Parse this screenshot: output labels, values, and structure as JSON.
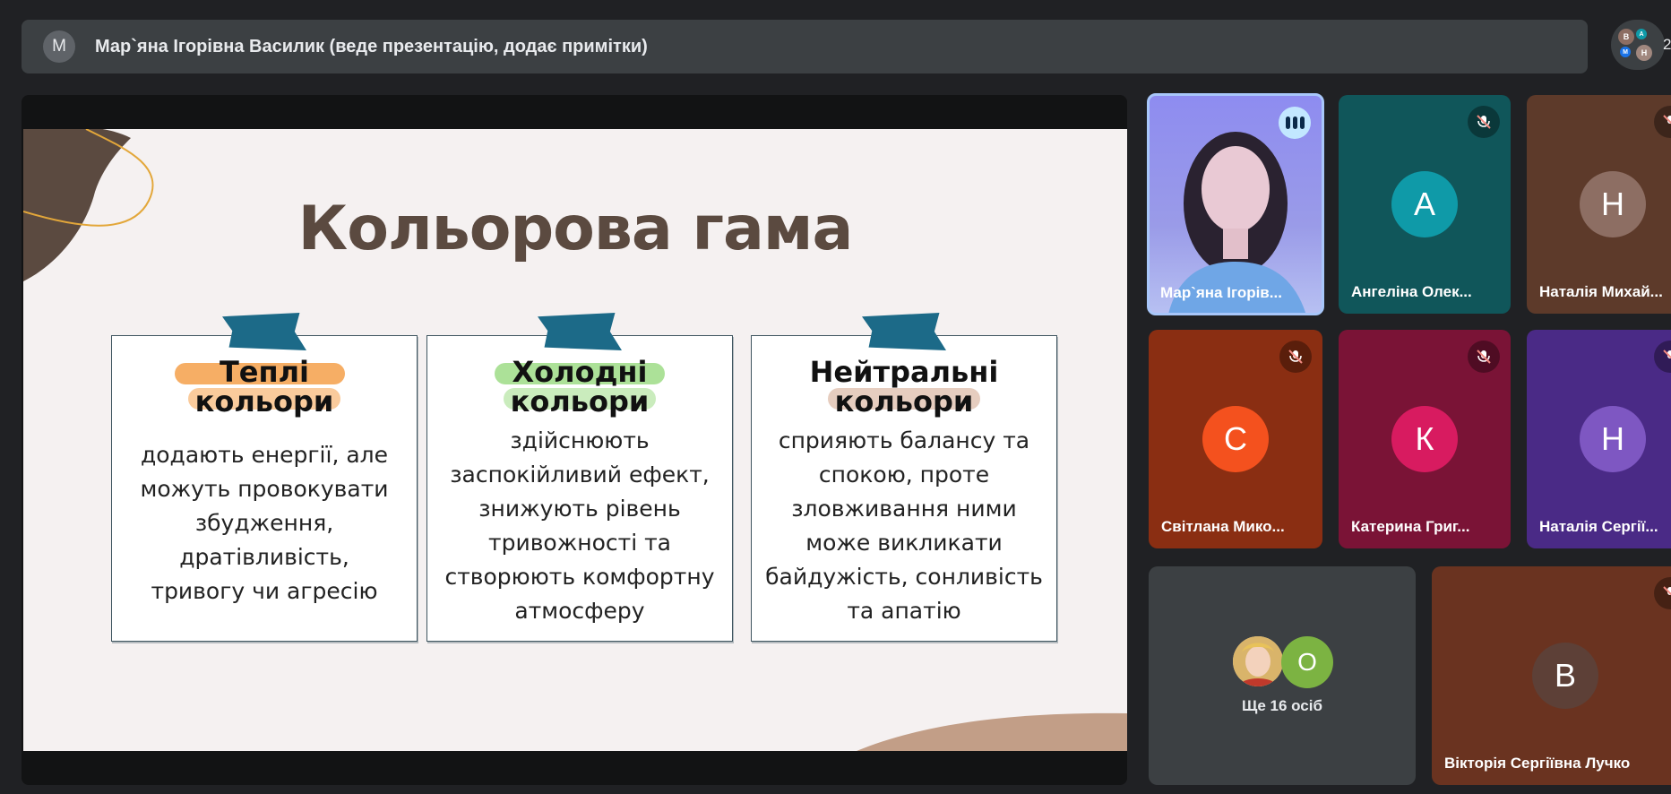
{
  "banner": {
    "avatar_letter": "M",
    "presenter_text": "Мар`яна Ігорівна Василик (веде презентацію, додає примітки)"
  },
  "people_cluster": {
    "avatars": [
      "В",
      "А",
      "М",
      "Н"
    ],
    "count": "2"
  },
  "slide": {
    "title": "Кольорова гама",
    "cards": [
      {
        "heading_line1": "Теплі",
        "heading_line2": "кольори",
        "highlight_color": "#f5a04a",
        "body": [
          "додають енергії, але",
          "можуть провокувати",
          "збудження,",
          "дратівливість,",
          "тривогу чи агресію"
        ]
      },
      {
        "heading_line1": "Холодні",
        "heading_line2": "кольори",
        "highlight_color": "#9edc86",
        "body": [
          "здійснюють",
          "заспокійливий ефект,",
          "знижують рівень",
          "тривожності та",
          "створюють комфортну",
          "атмосферу"
        ]
      },
      {
        "heading_line1": "Нейтральні",
        "heading_line2": "кольори",
        "highlight_color": "#e2c4b4",
        "body": [
          "сприяють балансу та",
          "спокою, проте",
          "зловживання ними",
          "може викликати",
          "байдужість, сонливість",
          "та апатію"
        ]
      }
    ]
  },
  "participants": [
    {
      "name": "Мар`яна Ігорів...",
      "type": "video",
      "speaking": true
    },
    {
      "name": "Ангеліна Олек...",
      "letter": "А",
      "avatar_color": "#0f9aa8",
      "bg": "#10565a",
      "muted": true
    },
    {
      "name": "Наталія Михай...",
      "letter": "Н",
      "avatar_color": "#8d6e63",
      "bg": "#5d3a2a",
      "muted": true
    },
    {
      "name": "Світлана Мико...",
      "letter": "С",
      "avatar_color": "#f4511e",
      "bg": "#8a2e12",
      "muted": true
    },
    {
      "name": "Катерина Григ...",
      "letter": "К",
      "avatar_color": "#d81b60",
      "bg": "#7a1336",
      "muted": true
    },
    {
      "name": "Наталія Сергії...",
      "letter": "Н",
      "avatar_color": "#7e57c2",
      "bg": "#4a2a86",
      "muted": true
    },
    {
      "more_label": "Ще 16 осіб",
      "extra_letter": "О",
      "extra_color": "#7cb342"
    },
    {
      "name": "Вікторія Сергіївна Лучко",
      "letter": "В",
      "avatar_color": "#5d4037",
      "bg": "#6a3320",
      "muted": true
    }
  ]
}
